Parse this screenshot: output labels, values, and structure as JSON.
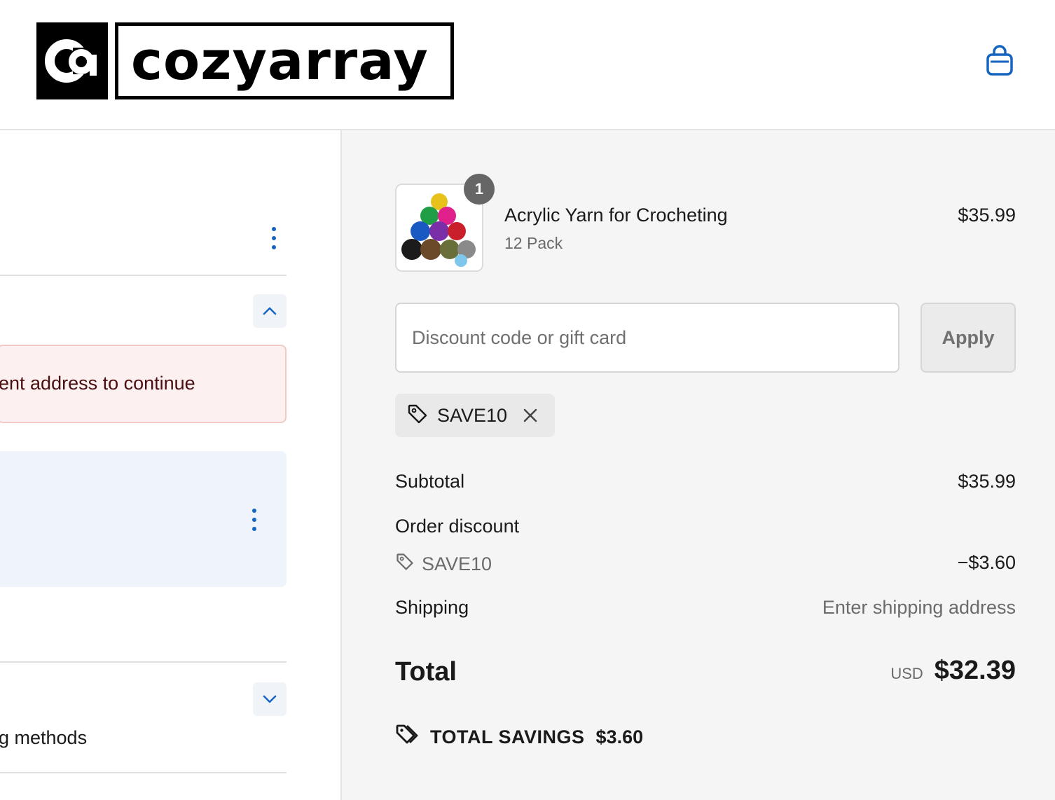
{
  "brand": {
    "name": "cozyarray",
    "mark_text": "CA"
  },
  "header": {
    "cart_icon": "shopping-bag-icon",
    "accent_color": "#1565c0"
  },
  "left_panel": {
    "error_message": "ent address to continue",
    "methods_text": "g methods"
  },
  "order": {
    "item": {
      "title": "Acrylic Yarn for Crocheting",
      "variant": "12 Pack",
      "price": "$35.99",
      "quantity": "1",
      "image_icon": "yarn-balls-image"
    },
    "discount": {
      "placeholder": "Discount code or gift card",
      "apply_label": "Apply",
      "applied_code": "SAVE10"
    },
    "summary": {
      "subtotal_label": "Subtotal",
      "subtotal_value": "$35.99",
      "order_discount_label": "Order discount",
      "discount_code": "SAVE10",
      "discount_value": "−$3.60",
      "shipping_label": "Shipping",
      "shipping_value": "Enter shipping address",
      "total_label": "Total",
      "currency": "USD",
      "total_value": "$32.39",
      "savings_label": "TOTAL SAVINGS",
      "savings_value": "$3.60"
    }
  }
}
